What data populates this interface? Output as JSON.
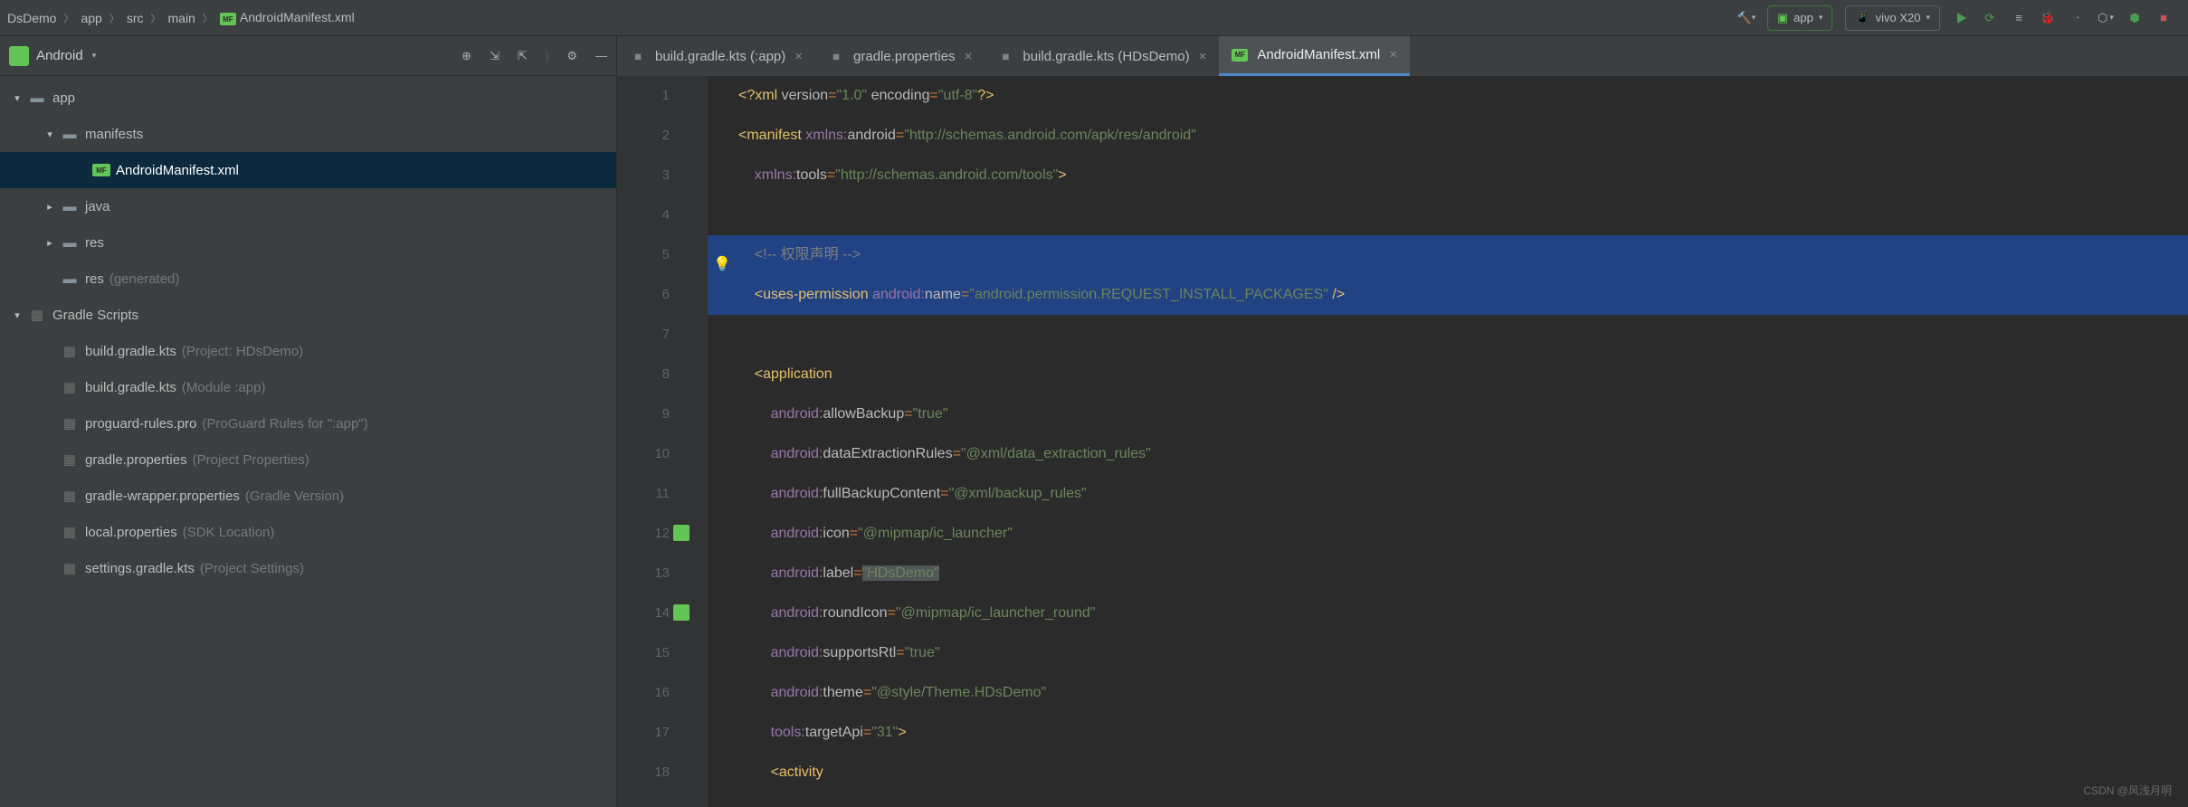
{
  "breadcrumb": {
    "items": [
      "DsDemo",
      "app",
      "src",
      "main",
      "AndroidManifest.xml"
    ]
  },
  "toolbar": {
    "run_config": "app",
    "device": "vivo X20"
  },
  "project_pane": {
    "title": "Android",
    "tree": [
      {
        "label": "app",
        "depth": 0,
        "chev": "▾",
        "icon": "pkg"
      },
      {
        "label": "manifests",
        "depth": 1,
        "chev": "▾",
        "icon": "folder"
      },
      {
        "label": "AndroidManifest.xml",
        "depth": 2,
        "chev": "",
        "icon": "mf",
        "sel": true
      },
      {
        "label": "java",
        "depth": 1,
        "chev": "▸",
        "icon": "folder"
      },
      {
        "label": "res",
        "depth": 1,
        "chev": "▸",
        "icon": "folder"
      },
      {
        "label": "res",
        "extra": "(generated)",
        "depth": 1,
        "chev": "",
        "icon": "folder"
      },
      {
        "label": "Gradle Scripts",
        "depth": 0,
        "chev": "▾",
        "icon": "gradle"
      },
      {
        "label": "build.gradle.kts",
        "extra": "(Project: HDsDemo)",
        "depth": 1,
        "chev": "",
        "icon": "gradle"
      },
      {
        "label": "build.gradle.kts",
        "extra": "(Module :app)",
        "depth": 1,
        "chev": "",
        "icon": "gradle"
      },
      {
        "label": "proguard-rules.pro",
        "extra": "(ProGuard Rules for \":app\")",
        "depth": 1,
        "chev": "",
        "icon": "props"
      },
      {
        "label": "gradle.properties",
        "extra": "(Project Properties)",
        "depth": 1,
        "chev": "",
        "icon": "props"
      },
      {
        "label": "gradle-wrapper.properties",
        "extra": "(Gradle Version)",
        "depth": 1,
        "chev": "",
        "icon": "props"
      },
      {
        "label": "local.properties",
        "extra": "(SDK Location)",
        "depth": 1,
        "chev": "",
        "icon": "props"
      },
      {
        "label": "settings.gradle.kts",
        "extra": "(Project Settings)",
        "depth": 1,
        "chev": "",
        "icon": "gradle"
      }
    ]
  },
  "tabs": [
    {
      "label": "build.gradle.kts (:app)",
      "icon": "gradle"
    },
    {
      "label": "gradle.properties",
      "icon": "props"
    },
    {
      "label": "build.gradle.kts (HDsDemo)",
      "icon": "gradle"
    },
    {
      "label": "AndroidManifest.xml",
      "icon": "mf",
      "active": true
    }
  ],
  "code": {
    "lines": [
      {
        "n": 1,
        "html": "<span class='tag'>&lt;?xml</span> <span class='attr-nm'>version</span><span class='op'>=</span><span class='str'>\"1.0\"</span> <span class='attr-nm'>encoding</span><span class='op'>=</span><span class='str'>\"utf-8\"</span><span class='tag'>?&gt;</span>"
      },
      {
        "n": 2,
        "html": "<span class='tag'>&lt;manifest</span> <span class='attr-ns'>xmlns:</span><span class='attr-nm'>android</span><span class='op'>=</span><span class='str'>\"http://schemas.android.com/apk/res/android\"</span>"
      },
      {
        "n": 3,
        "html": "    <span class='attr-ns'>xmlns:</span><span class='attr-nm'>tools</span><span class='op'>=</span><span class='str'>\"http://schemas.android.com/tools\"</span><span class='tag'>&gt;</span>"
      },
      {
        "n": 4,
        "html": ""
      },
      {
        "n": 5,
        "hi": true,
        "bulb": true,
        "html": "    <span class='cmt'>&lt;!-- 权限声明 --&gt;</span>"
      },
      {
        "n": 6,
        "hi": true,
        "html": "    <span class='tag'>&lt;uses-permission</span> <span class='attr-ns'>android:</span><span class='attr-nm'>name</span><span class='op'>=</span><span class='str'>\"android.permission.REQUEST_INSTALL_PACKAGES\"</span> <span class='tag'>/&gt;</span>"
      },
      {
        "n": 7,
        "html": ""
      },
      {
        "n": 8,
        "html": "    <span class='tag'>&lt;application</span>"
      },
      {
        "n": 9,
        "html": "        <span class='attr-ns'>android:</span><span class='attr-nm'>allowBackup</span><span class='op'>=</span><span class='str'>\"true\"</span>"
      },
      {
        "n": 10,
        "html": "        <span class='attr-ns'>android:</span><span class='attr-nm'>dataExtractionRules</span><span class='op'>=</span><span class='str'>\"@xml/data_extraction_rules\"</span>"
      },
      {
        "n": 11,
        "html": "        <span class='attr-ns'>android:</span><span class='attr-nm'>fullBackupContent</span><span class='op'>=</span><span class='str'>\"@xml/backup_rules\"</span>"
      },
      {
        "n": 12,
        "gicon": true,
        "html": "        <span class='attr-ns'>android:</span><span class='attr-nm'>icon</span><span class='op'>=</span><span class='str'>\"@mipmap/ic_launcher\"</span>"
      },
      {
        "n": 13,
        "html": "        <span class='attr-ns'>android:</span><span class='attr-nm'>label</span><span class='op'>=</span><span class='str dim-bg'>\"HDsDemo\"</span>"
      },
      {
        "n": 14,
        "gicon": true,
        "html": "        <span class='attr-ns'>android:</span><span class='attr-nm'>roundIcon</span><span class='op'>=</span><span class='str'>\"@mipmap/ic_launcher_round\"</span>"
      },
      {
        "n": 15,
        "html": "        <span class='attr-ns'>android:</span><span class='attr-nm'>supportsRtl</span><span class='op'>=</span><span class='str'>\"true\"</span>"
      },
      {
        "n": 16,
        "html": "        <span class='attr-ns'>android:</span><span class='attr-nm'>theme</span><span class='op'>=</span><span class='str'>\"@style/Theme.HDsDemo\"</span>"
      },
      {
        "n": 17,
        "html": "        <span class='attr-ns'>tools:</span><span class='attr-nm'>targetApi</span><span class='op'>=</span><span class='str'>\"31\"</span><span class='tag'>&gt;</span>"
      },
      {
        "n": 18,
        "html": "        <span class='tag'>&lt;activity</span>"
      }
    ]
  },
  "watermark": "CSDN @风浅月明"
}
